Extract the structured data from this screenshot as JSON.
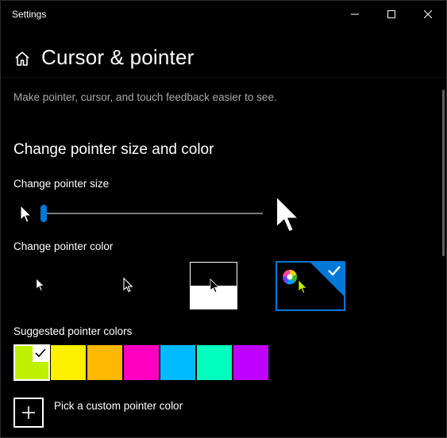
{
  "window": {
    "title": "Settings"
  },
  "header": {
    "title": "Cursor & pointer",
    "home_icon": "home-icon"
  },
  "content": {
    "description": "Make pointer, cursor, and touch feedback easier to see.",
    "section_title": "Change pointer size and color",
    "size_label": "Change pointer size",
    "size_value_fraction": 0.0,
    "color_label": "Change pointer color",
    "color_options": [
      {
        "name": "white",
        "selected": false
      },
      {
        "name": "black",
        "selected": false
      },
      {
        "name": "inverted",
        "selected": false
      },
      {
        "name": "custom",
        "selected": true
      }
    ],
    "suggested_label": "Suggested pointer colors",
    "suggested_colors": [
      "#bff000",
      "#fff000",
      "#ffb900",
      "#ff00c0",
      "#00baff",
      "#00ffbf",
      "#bf00ff"
    ],
    "selected_suggested_index": 0,
    "pick_custom_label": "Pick a custom pointer color"
  },
  "colors": {
    "accent": "#0078d7",
    "background": "#000000",
    "custom_pointer": "#bff000"
  }
}
